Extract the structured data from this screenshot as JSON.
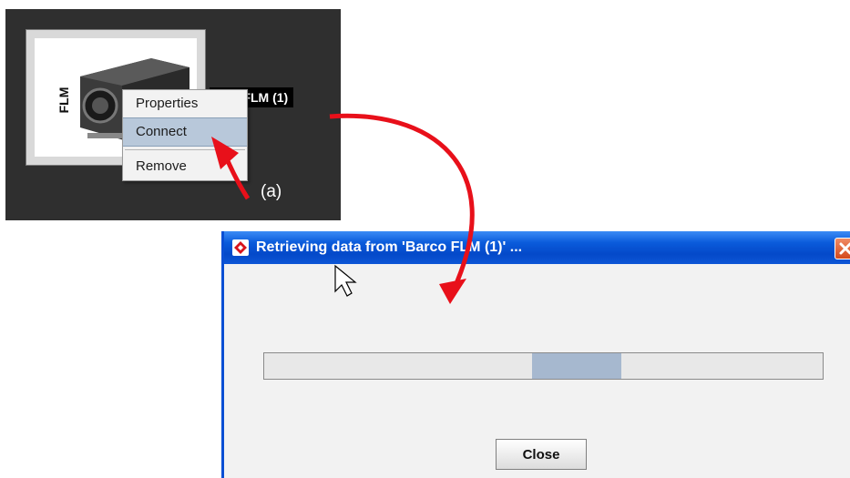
{
  "device": {
    "thumb_label": "FLM",
    "name": "o FLM (1)",
    "icon": "projector-icon"
  },
  "context_menu": {
    "items": [
      {
        "label": "Properties"
      },
      {
        "label": "Connect",
        "selected": true
      },
      {
        "label": "Remove"
      }
    ]
  },
  "annotation": {
    "label": "(a)"
  },
  "dialog": {
    "title": "Retrieving data from 'Barco FLM (1)' ...",
    "title_icon": "app-logo-icon",
    "close_icon": "close-icon",
    "progress": {
      "indeterminate": true,
      "chunk_start": 0.48,
      "chunk_end": 0.64
    },
    "close_button_label": "Close"
  },
  "colors": {
    "titlebar": "#0a5bdb",
    "annotation_arrow": "#e8101a",
    "progress_chunk": "#a6b8cf",
    "menu_highlight": "#b8c8da"
  }
}
